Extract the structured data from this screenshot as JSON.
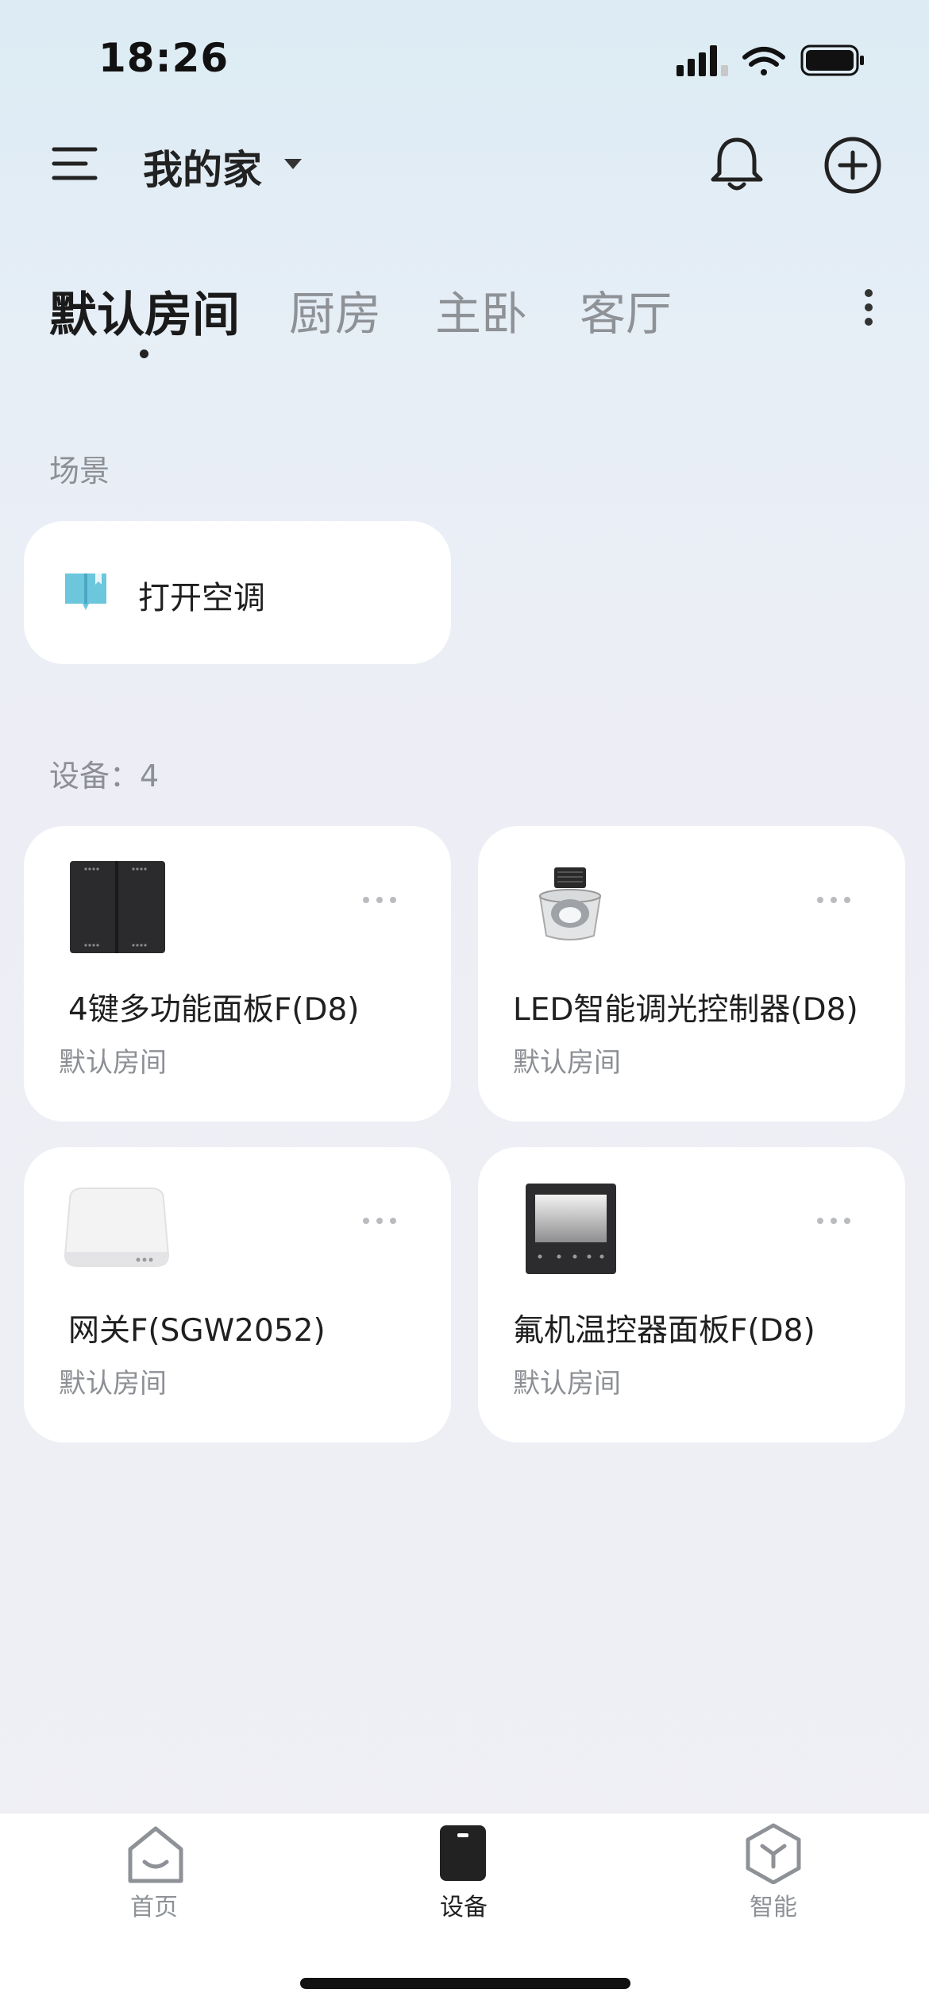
{
  "status_bar": {
    "time": "18:26",
    "icons": [
      "cellular-signal-icon",
      "wifi-icon",
      "battery-icon"
    ]
  },
  "header": {
    "home_name": "我的家",
    "menu_icon": "menu-icon",
    "notification_icon": "bell-icon",
    "add_icon": "plus-circle-icon"
  },
  "rooms": {
    "tabs": [
      {
        "label": "默认房间",
        "active": true
      },
      {
        "label": "厨房",
        "active": false
      },
      {
        "label": "主卧",
        "active": false
      },
      {
        "label": "客厅",
        "active": false
      }
    ],
    "more_icon": "vertical-dots-icon"
  },
  "scenes": {
    "section_label": "场景",
    "items": [
      {
        "label": "打开空调",
        "icon": "scene-book-icon",
        "icon_color": "#6cc6dc"
      }
    ]
  },
  "devices": {
    "section_label": "设备：4",
    "items": [
      {
        "name": "4键多功能面板F(D8)",
        "room": "默认房间",
        "image": "four-key-panel-image"
      },
      {
        "name": "LED智能调光控制器(D8)",
        "room": "默认房间",
        "image": "led-downlight-image"
      },
      {
        "name": "网关F(SGW2052)",
        "room": "默认房间",
        "image": "gateway-image"
      },
      {
        "name": "氟机温控器面板F(D8)",
        "room": "默认房间",
        "image": "thermostat-panel-image"
      }
    ]
  },
  "bottom_nav": {
    "items": [
      {
        "label": "首页",
        "icon": "home-icon",
        "active": false
      },
      {
        "label": "设备",
        "icon": "device-icon",
        "active": true
      },
      {
        "label": "智能",
        "icon": "smart-cube-icon",
        "active": false
      }
    ]
  },
  "colors": {
    "accent": "#1a1a1a",
    "scene_icon": "#6cc6dc",
    "muted_text": "#8c8f94"
  }
}
